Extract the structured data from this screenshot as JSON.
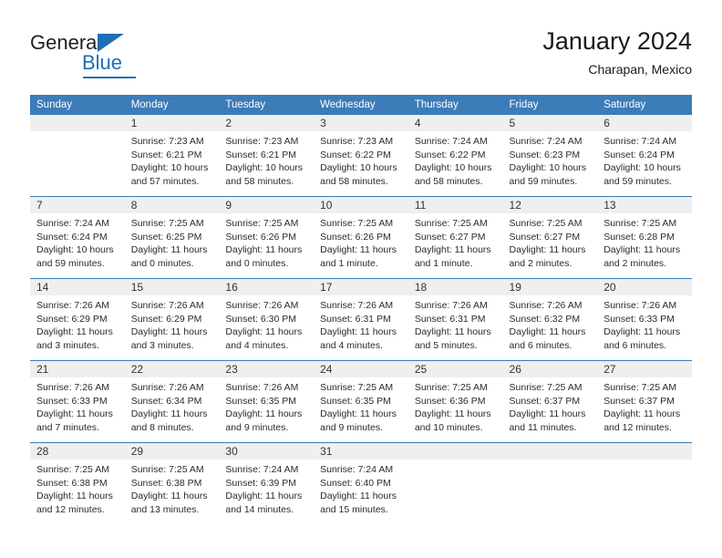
{
  "brand": {
    "name_part1": "General",
    "name_part2": "Blue",
    "logo_icon": "triangle-flag-icon",
    "accent_color": "#1f6fb5"
  },
  "header": {
    "title": "January 2024",
    "subtitle": "Charapan, Mexico"
  },
  "calendar": {
    "header_bg": "#3b7cb9",
    "daynum_bg": "#efefef",
    "weekday_headers": [
      "Sunday",
      "Monday",
      "Tuesday",
      "Wednesday",
      "Thursday",
      "Friday",
      "Saturday"
    ],
    "weeks": [
      [
        {
          "day": "",
          "sunrise": "",
          "sunset": "",
          "daylight": "",
          "empty": true
        },
        {
          "day": "1",
          "sunrise": "Sunrise: 7:23 AM",
          "sunset": "Sunset: 6:21 PM",
          "daylight": "Daylight: 10 hours and 57 minutes."
        },
        {
          "day": "2",
          "sunrise": "Sunrise: 7:23 AM",
          "sunset": "Sunset: 6:21 PM",
          "daylight": "Daylight: 10 hours and 58 minutes."
        },
        {
          "day": "3",
          "sunrise": "Sunrise: 7:23 AM",
          "sunset": "Sunset: 6:22 PM",
          "daylight": "Daylight: 10 hours and 58 minutes."
        },
        {
          "day": "4",
          "sunrise": "Sunrise: 7:24 AM",
          "sunset": "Sunset: 6:22 PM",
          "daylight": "Daylight: 10 hours and 58 minutes."
        },
        {
          "day": "5",
          "sunrise": "Sunrise: 7:24 AM",
          "sunset": "Sunset: 6:23 PM",
          "daylight": "Daylight: 10 hours and 59 minutes."
        },
        {
          "day": "6",
          "sunrise": "Sunrise: 7:24 AM",
          "sunset": "Sunset: 6:24 PM",
          "daylight": "Daylight: 10 hours and 59 minutes."
        }
      ],
      [
        {
          "day": "7",
          "sunrise": "Sunrise: 7:24 AM",
          "sunset": "Sunset: 6:24 PM",
          "daylight": "Daylight: 10 hours and 59 minutes."
        },
        {
          "day": "8",
          "sunrise": "Sunrise: 7:25 AM",
          "sunset": "Sunset: 6:25 PM",
          "daylight": "Daylight: 11 hours and 0 minutes."
        },
        {
          "day": "9",
          "sunrise": "Sunrise: 7:25 AM",
          "sunset": "Sunset: 6:26 PM",
          "daylight": "Daylight: 11 hours and 0 minutes."
        },
        {
          "day": "10",
          "sunrise": "Sunrise: 7:25 AM",
          "sunset": "Sunset: 6:26 PM",
          "daylight": "Daylight: 11 hours and 1 minute."
        },
        {
          "day": "11",
          "sunrise": "Sunrise: 7:25 AM",
          "sunset": "Sunset: 6:27 PM",
          "daylight": "Daylight: 11 hours and 1 minute."
        },
        {
          "day": "12",
          "sunrise": "Sunrise: 7:25 AM",
          "sunset": "Sunset: 6:27 PM",
          "daylight": "Daylight: 11 hours and 2 minutes."
        },
        {
          "day": "13",
          "sunrise": "Sunrise: 7:25 AM",
          "sunset": "Sunset: 6:28 PM",
          "daylight": "Daylight: 11 hours and 2 minutes."
        }
      ],
      [
        {
          "day": "14",
          "sunrise": "Sunrise: 7:26 AM",
          "sunset": "Sunset: 6:29 PM",
          "daylight": "Daylight: 11 hours and 3 minutes."
        },
        {
          "day": "15",
          "sunrise": "Sunrise: 7:26 AM",
          "sunset": "Sunset: 6:29 PM",
          "daylight": "Daylight: 11 hours and 3 minutes."
        },
        {
          "day": "16",
          "sunrise": "Sunrise: 7:26 AM",
          "sunset": "Sunset: 6:30 PM",
          "daylight": "Daylight: 11 hours and 4 minutes."
        },
        {
          "day": "17",
          "sunrise": "Sunrise: 7:26 AM",
          "sunset": "Sunset: 6:31 PM",
          "daylight": "Daylight: 11 hours and 4 minutes."
        },
        {
          "day": "18",
          "sunrise": "Sunrise: 7:26 AM",
          "sunset": "Sunset: 6:31 PM",
          "daylight": "Daylight: 11 hours and 5 minutes."
        },
        {
          "day": "19",
          "sunrise": "Sunrise: 7:26 AM",
          "sunset": "Sunset: 6:32 PM",
          "daylight": "Daylight: 11 hours and 6 minutes."
        },
        {
          "day": "20",
          "sunrise": "Sunrise: 7:26 AM",
          "sunset": "Sunset: 6:33 PM",
          "daylight": "Daylight: 11 hours and 6 minutes."
        }
      ],
      [
        {
          "day": "21",
          "sunrise": "Sunrise: 7:26 AM",
          "sunset": "Sunset: 6:33 PM",
          "daylight": "Daylight: 11 hours and 7 minutes."
        },
        {
          "day": "22",
          "sunrise": "Sunrise: 7:26 AM",
          "sunset": "Sunset: 6:34 PM",
          "daylight": "Daylight: 11 hours and 8 minutes."
        },
        {
          "day": "23",
          "sunrise": "Sunrise: 7:26 AM",
          "sunset": "Sunset: 6:35 PM",
          "daylight": "Daylight: 11 hours and 9 minutes."
        },
        {
          "day": "24",
          "sunrise": "Sunrise: 7:25 AM",
          "sunset": "Sunset: 6:35 PM",
          "daylight": "Daylight: 11 hours and 9 minutes."
        },
        {
          "day": "25",
          "sunrise": "Sunrise: 7:25 AM",
          "sunset": "Sunset: 6:36 PM",
          "daylight": "Daylight: 11 hours and 10 minutes."
        },
        {
          "day": "26",
          "sunrise": "Sunrise: 7:25 AM",
          "sunset": "Sunset: 6:37 PM",
          "daylight": "Daylight: 11 hours and 11 minutes."
        },
        {
          "day": "27",
          "sunrise": "Sunrise: 7:25 AM",
          "sunset": "Sunset: 6:37 PM",
          "daylight": "Daylight: 11 hours and 12 minutes."
        }
      ],
      [
        {
          "day": "28",
          "sunrise": "Sunrise: 7:25 AM",
          "sunset": "Sunset: 6:38 PM",
          "daylight": "Daylight: 11 hours and 12 minutes."
        },
        {
          "day": "29",
          "sunrise": "Sunrise: 7:25 AM",
          "sunset": "Sunset: 6:38 PM",
          "daylight": "Daylight: 11 hours and 13 minutes."
        },
        {
          "day": "30",
          "sunrise": "Sunrise: 7:24 AM",
          "sunset": "Sunset: 6:39 PM",
          "daylight": "Daylight: 11 hours and 14 minutes."
        },
        {
          "day": "31",
          "sunrise": "Sunrise: 7:24 AM",
          "sunset": "Sunset: 6:40 PM",
          "daylight": "Daylight: 11 hours and 15 minutes."
        },
        {
          "day": "",
          "sunrise": "",
          "sunset": "",
          "daylight": "",
          "empty": true
        },
        {
          "day": "",
          "sunrise": "",
          "sunset": "",
          "daylight": "",
          "empty": true
        },
        {
          "day": "",
          "sunrise": "",
          "sunset": "",
          "daylight": "",
          "empty": true
        }
      ]
    ]
  }
}
